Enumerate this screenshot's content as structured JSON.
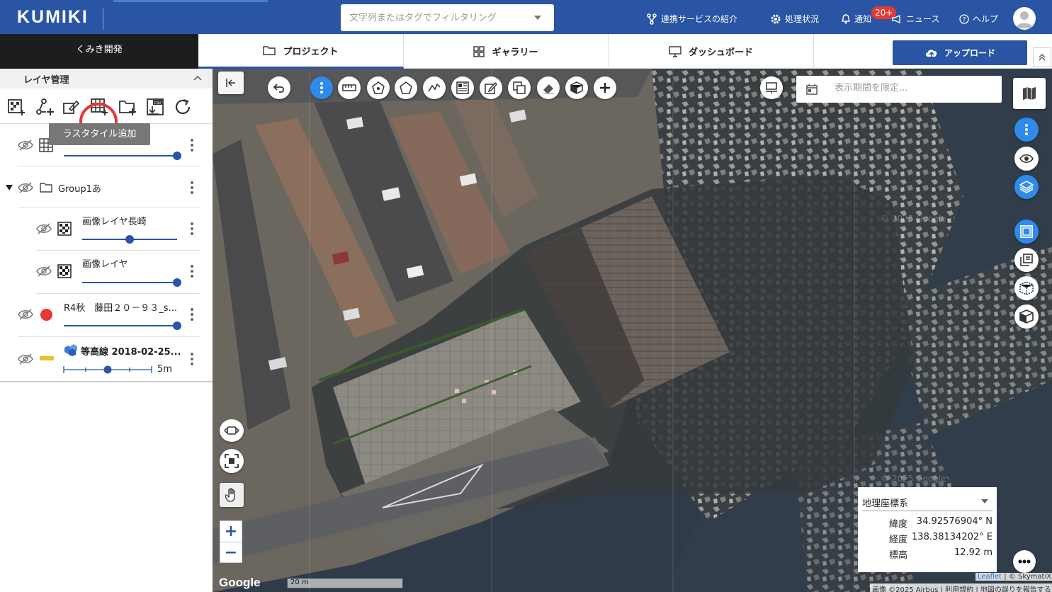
{
  "app": {
    "logo": "KUMIKI"
  },
  "search": {
    "placeholder": "文字列またはタグでフィルタリング"
  },
  "nav": {
    "integration": "連携サービスの紹介",
    "processing": "処理状況",
    "notification": "通知",
    "notification_badge": "20+",
    "news": "ニュース",
    "help": "ヘルプ"
  },
  "workspace": {
    "name": "くみき開発"
  },
  "tabs": [
    {
      "label": "プロジェクト",
      "icon": "folder-icon",
      "active": true
    },
    {
      "label": "ギャラリー",
      "icon": "grid-icon",
      "active": false
    },
    {
      "label": "ダッシュボード",
      "icon": "monitor-icon",
      "active": false
    }
  ],
  "upload": {
    "label": "アップロード"
  },
  "layer_panel": {
    "title": "レイヤ管理",
    "tooltip": "ラスタタイル追加",
    "layers": [
      {
        "name": "",
        "icon": "grid-icon",
        "opacity": 1.0
      },
      {
        "name": "Group1あ",
        "icon": "folder-icon"
      },
      {
        "name": "画像レイヤ長崎",
        "icon": "checker-icon",
        "opacity": 0.5
      },
      {
        "name": "画像レイヤ",
        "icon": "checker-icon",
        "opacity": 1.0
      },
      {
        "name": "R4秋　藤田２０－９３_s...",
        "icon": "red-dot-icon",
        "opacity": 1.0,
        "color": "#e53935"
      },
      {
        "name": "等高線 2018-02-25...",
        "icon": "cubes-icon",
        "color": "#e6c02d",
        "interval_label": "5m"
      }
    ]
  },
  "map": {
    "date_placeholder": "表示期間を限定...",
    "coord_system": "地理座標系",
    "latitude_label": "緯度",
    "latitude": "34.92576904° N",
    "longitude_label": "経度",
    "longitude": "138.38134202° E",
    "elevation_label": "標高",
    "elevation": "12.92 m",
    "scale": "20 m",
    "google": "Google",
    "watermark": "© 2025 Google",
    "attribution_leaflet": "Leaflet",
    "attribution_sky": "| © SkymatiX",
    "attribution_imagery": "画像 ©2025 Airbus",
    "attribution_terms": "利用規約",
    "attribution_report": "地図の誤りを報告する",
    "zoom_in": "+",
    "zoom_out": "−"
  },
  "colors": {
    "primary": "#2a55a5",
    "accent_blue": "#2e8bea",
    "alert": "#e53935"
  }
}
